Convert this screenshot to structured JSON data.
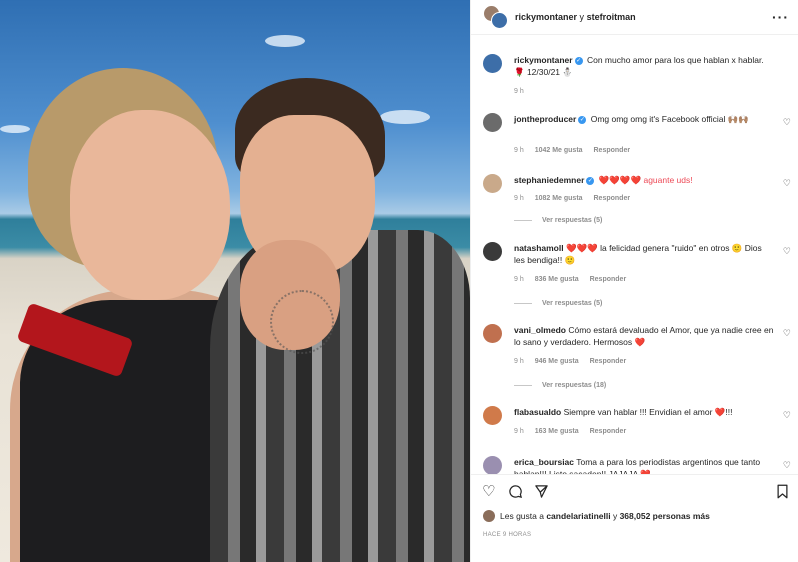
{
  "header": {
    "user1": "rickymontaner",
    "and": "y",
    "user2": "stefroitman"
  },
  "caption": {
    "username": "rickymontaner",
    "text": "Con mucho amor para los que hablan x hablar. 🌹 12/30/21 ⛄",
    "time": "9 h"
  },
  "comments": [
    {
      "username": "jontheproducer",
      "verified": true,
      "text": "Omg omg omg it's Facebook official 🙌🏽🙌🏽",
      "time": "9 h",
      "likes": "1042 Me gusta",
      "reply": "Responder",
      "replies": "",
      "avatar_color": "#6b6b6b"
    },
    {
      "username": "stephaniedemner",
      "verified": true,
      "text": "❤️❤️❤️❤️ aguante uds!",
      "time": "9 h",
      "likes": "1082 Me gusta",
      "reply": "Responder",
      "replies": "Ver respuestas (5)",
      "avatar_color": "#c9a98a"
    },
    {
      "username": "natashamoll",
      "verified": false,
      "text": "❤️❤️❤️ la felicidad genera \"ruido\" en otros 🙂 Dios les bendiga!! 🙂",
      "time": "9 h",
      "likes": "836 Me gusta",
      "reply": "Responder",
      "replies": "Ver respuestas (5)",
      "avatar_color": "#3a3a3a"
    },
    {
      "username": "vani_olmedo",
      "verified": false,
      "text": "Cómo estará devaluado el Amor, que ya nadie cree en lo sano y verdadero. Hermosos ❤️",
      "time": "9 h",
      "likes": "946 Me gusta",
      "reply": "Responder",
      "replies": "Ver respuestas (18)",
      "avatar_color": "#c0704f"
    },
    {
      "username": "flabasualdo",
      "verified": false,
      "text": "Siempre van hablar !!! Envidian el amor ❤️!!!",
      "time": "9 h",
      "likes": "163 Me gusta",
      "reply": "Responder",
      "replies": "",
      "avatar_color": "#d07a4a"
    },
    {
      "username": "erica_boursiac",
      "verified": false,
      "text": "Toma a para los periodistas argentinos que tanto hablan!!! Listo sacaden!! JAJAJA ❤️",
      "time": "",
      "likes": "",
      "reply": "",
      "replies": "",
      "avatar_color": "#9a8fb0"
    }
  ],
  "likes_line": {
    "prefix": "Les gusta a",
    "user": "candelariatinelli",
    "middle": "y",
    "count": "368,052 personas más"
  },
  "timestamp": "HACE 9 HORAS",
  "icons": {
    "more": "more-options-icon",
    "like": "heart-icon",
    "comment": "comment-icon",
    "share": "share-icon",
    "save": "bookmark-icon"
  }
}
